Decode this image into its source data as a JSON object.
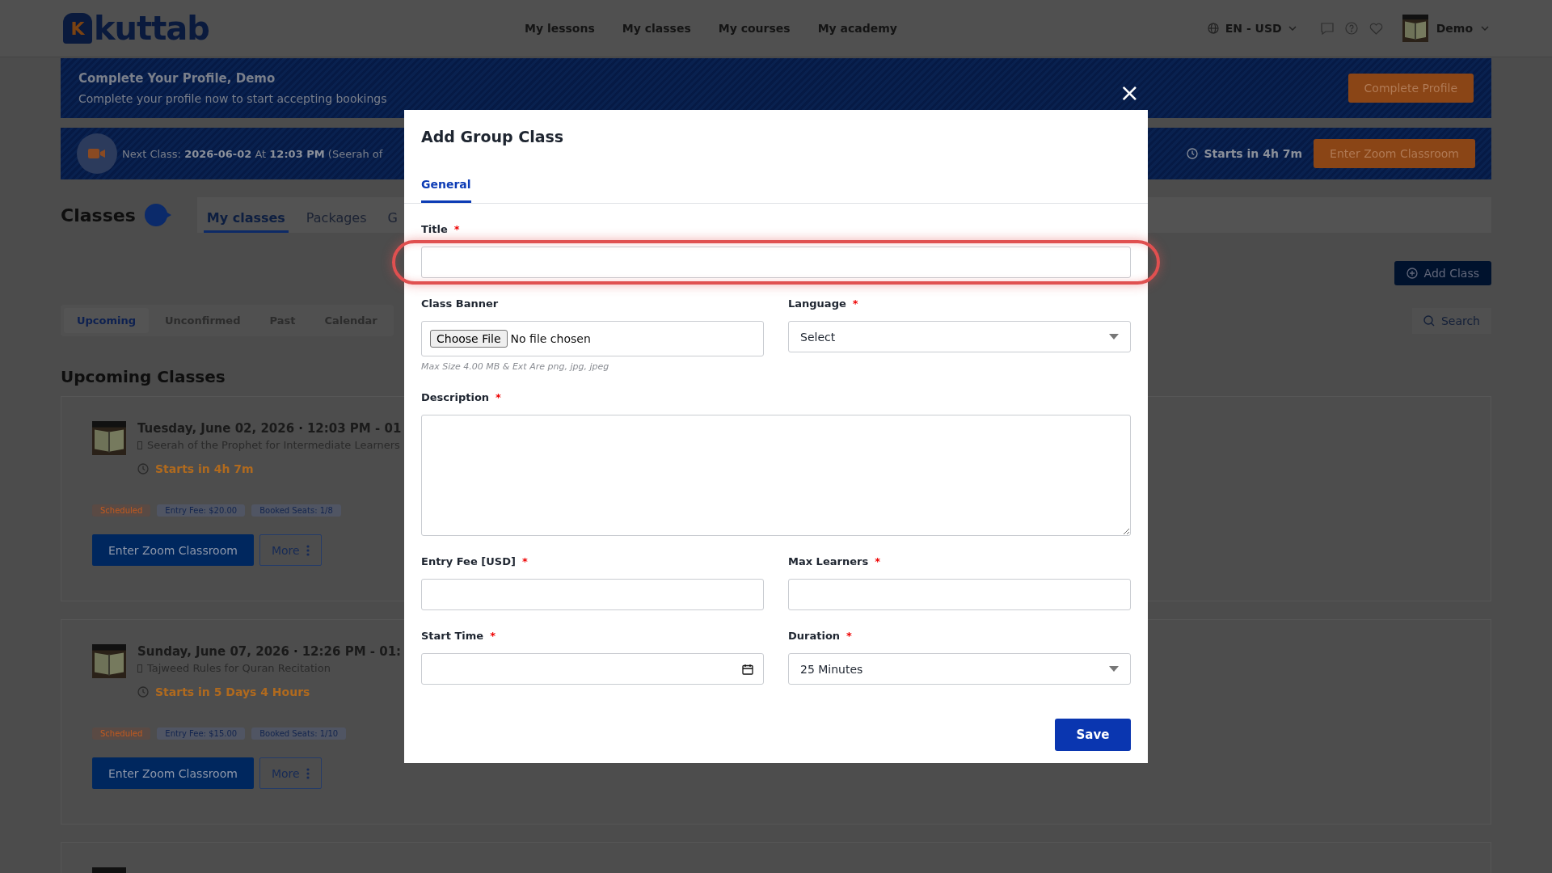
{
  "header": {
    "logo_letter": "K",
    "logo_text": "kuttab",
    "nav": [
      {
        "label": "My lessons"
      },
      {
        "label": "My classes"
      },
      {
        "label": "My courses"
      },
      {
        "label": "My academy"
      }
    ],
    "locale": "EN - USD",
    "user": "Demo"
  },
  "profile_banner": {
    "title": "Complete Your Profile, Demo",
    "text": "Complete your profile now to start accepting bookings",
    "button": "Complete Profile"
  },
  "next_class": {
    "text": "Next Class: **2026-06-02** At **12:03 PM** (Seerah of",
    "countdown": "Starts in 4h 7m",
    "button": "Enter Zoom Classroom"
  },
  "classes_page": {
    "title": "Classes",
    "tabs": [
      {
        "label": "My classes",
        "selected": true
      },
      {
        "label": "Packages",
        "selected": false
      },
      {
        "label": "G",
        "selected": false
      }
    ],
    "add_button": "Add Class",
    "filters": [
      {
        "label": "Upcoming",
        "selected": true
      },
      {
        "label": "Unconfirmed",
        "selected": false
      },
      {
        "label": "Past",
        "selected": false
      },
      {
        "label": "Calendar",
        "selected": false
      }
    ],
    "search": "Search",
    "section_title": "Upcoming Classes"
  },
  "classes": [
    {
      "date": "Tuesday, June 02, 2026",
      "sep": "·",
      "time": "12:03 PM - 01",
      "subject": "Seerah of the Prophet for Intermediate Learners",
      "countdown": "Starts in 4h 7m",
      "badges": [
        {
          "text": "Scheduled",
          "kind": "status"
        },
        {
          "text": "Entry Fee: $20.00",
          "kind": "info"
        },
        {
          "text": "Booked Seats: 1/8",
          "kind": "info"
        }
      ],
      "enter_button": "Enter Zoom Classroom",
      "more_button": "More"
    },
    {
      "date": "Sunday, June 07, 2026",
      "sep": "·",
      "time": "12:26 PM - 01:",
      "subject": "Tajweed Rules for Quran Recitation",
      "countdown": "Starts in 5 Days 4 Hours",
      "badges": [
        {
          "text": "Scheduled",
          "kind": "status"
        },
        {
          "text": "Entry Fee: $15.00",
          "kind": "info"
        },
        {
          "text": "Booked Seats: 1/10",
          "kind": "info"
        }
      ],
      "enter_button": "Enter Zoom Classroom",
      "more_button": "More"
    },
    {
      "kind": "cut"
    }
  ],
  "modal": {
    "title": "Add Group Class",
    "close": "×",
    "tabs": [
      {
        "label": "General",
        "selected": true
      }
    ],
    "rows": [
      [
        {
          "kind": "text",
          "label": "Title",
          "required_mark": "*",
          "highlighted": true
        }
      ],
      [
        {
          "kind": "file",
          "label": "Class Banner",
          "button": "Choose File",
          "value": "No file chosen",
          "hint": "Max Size 4.00 MB & Ext Are png, jpg, jpeg"
        },
        {
          "kind": "select",
          "label": "Language",
          "required_mark": "*",
          "value": "Select"
        }
      ],
      [
        {
          "kind": "textarea",
          "label": "Description",
          "required_mark": "*"
        }
      ],
      [
        {
          "kind": "text",
          "label": "Entry Fee [USD]",
          "required_mark": "*"
        },
        {
          "kind": "text",
          "label": "Max Learners",
          "required_mark": "*"
        }
      ],
      [
        {
          "kind": "date",
          "label": "Start Time",
          "required_mark": "*"
        },
        {
          "kind": "select",
          "label": "Duration",
          "required_mark": "*",
          "value": "25 Minutes"
        }
      ]
    ],
    "save_button": "Save"
  }
}
